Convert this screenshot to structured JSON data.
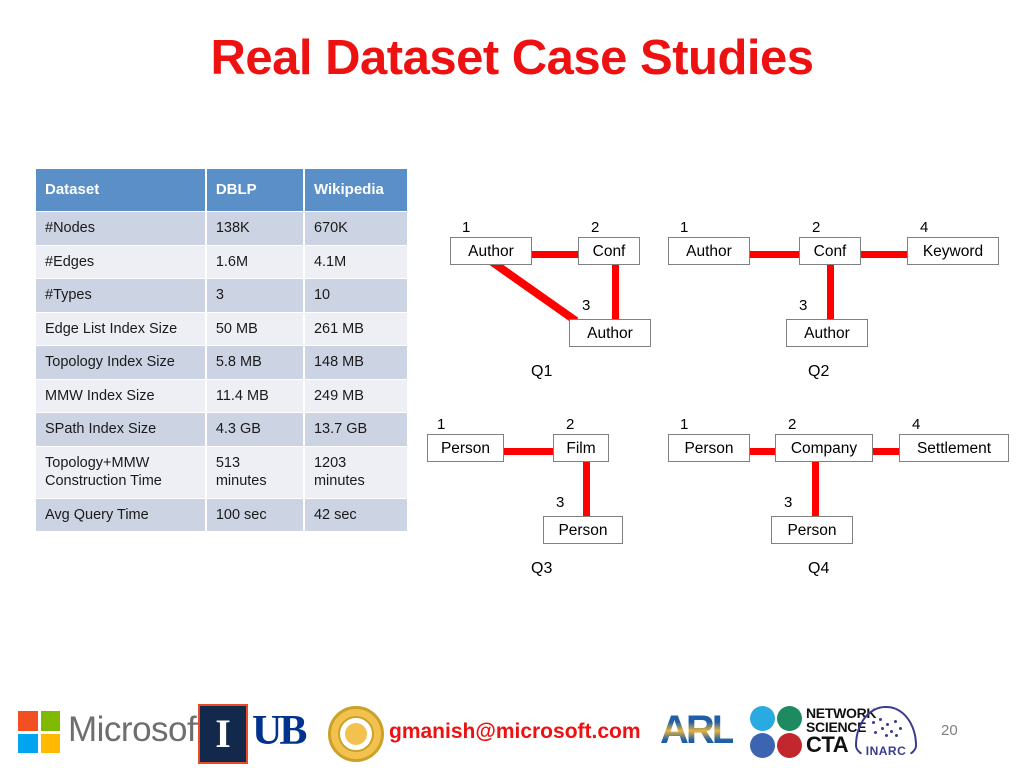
{
  "slide": {
    "title": "Real Dataset Case Studies",
    "number": "20"
  },
  "table": {
    "headers": [
      "Dataset",
      "DBLP",
      "Wikipedia"
    ],
    "rows": [
      {
        "label": "#Nodes",
        "dblp": "138K",
        "wikipedia": "670K"
      },
      {
        "label": "#Edges",
        "dblp": "1.6M",
        "wikipedia": "4.1M"
      },
      {
        "label": "#Types",
        "dblp": "3",
        "wikipedia": "10"
      },
      {
        "label": "Edge List Index Size",
        "dblp": "50 MB",
        "wikipedia": "261 MB"
      },
      {
        "label": "Topology Index Size",
        "dblp": "5.8 MB",
        "wikipedia": "148 MB"
      },
      {
        "label": "MMW Index Size",
        "dblp": "11.4 MB",
        "wikipedia": "249 MB"
      },
      {
        "label": "SPath Index Size",
        "dblp": "4.3 GB",
        "wikipedia": "13.7 GB"
      },
      {
        "label": "Topology+MMW Construction Time",
        "dblp": "513 minutes",
        "wikipedia": "1203 minutes"
      },
      {
        "label": "Avg Query Time",
        "dblp": "100 sec",
        "wikipedia": "42 sec"
      }
    ],
    "header_color": "#5B8FC8",
    "band_a_color": "#CCD4E4",
    "band_b_color": "#EDEFF5"
  },
  "queries": [
    {
      "name": "Q1",
      "nodes": [
        {
          "num": "1",
          "label": "Author"
        },
        {
          "num": "2",
          "label": "Conf"
        },
        {
          "num": "3",
          "label": "Author"
        }
      ],
      "edges": [
        "1-2",
        "2-3",
        "1-3"
      ]
    },
    {
      "name": "Q2",
      "nodes": [
        {
          "num": "1",
          "label": "Author"
        },
        {
          "num": "2",
          "label": "Conf"
        },
        {
          "num": "3",
          "label": "Author"
        },
        {
          "num": "4",
          "label": "Keyword"
        }
      ],
      "edges": [
        "1-2",
        "2-4",
        "2-3"
      ]
    },
    {
      "name": "Q3",
      "nodes": [
        {
          "num": "1",
          "label": "Person"
        },
        {
          "num": "2",
          "label": "Film"
        },
        {
          "num": "3",
          "label": "Person"
        }
      ],
      "edges": [
        "1-2",
        "2-3"
      ]
    },
    {
      "name": "Q4",
      "nodes": [
        {
          "num": "1",
          "label": "Person"
        },
        {
          "num": "2",
          "label": "Company"
        },
        {
          "num": "3",
          "label": "Person"
        },
        {
          "num": "4",
          "label": "Settlement"
        }
      ],
      "edges": [
        "1-2",
        "2-4",
        "2-3"
      ]
    }
  ],
  "footer": {
    "microsoft_wordmark": "Microsoft",
    "illinois_glyph": "I",
    "ub_wordmark": "UB",
    "email": "gmanish@microsoft.com",
    "arl_wordmark": "ARL",
    "netsci_line1": "NETWORK",
    "netsci_line2": "SCIENCE",
    "netsci_line3": "CTA",
    "inarc_wordmark": "INARC"
  },
  "colors": {
    "title_red": "#EE1111",
    "edge_red": "#FF0000",
    "box_border": "#808080",
    "slide_number_gray": "#808080"
  }
}
